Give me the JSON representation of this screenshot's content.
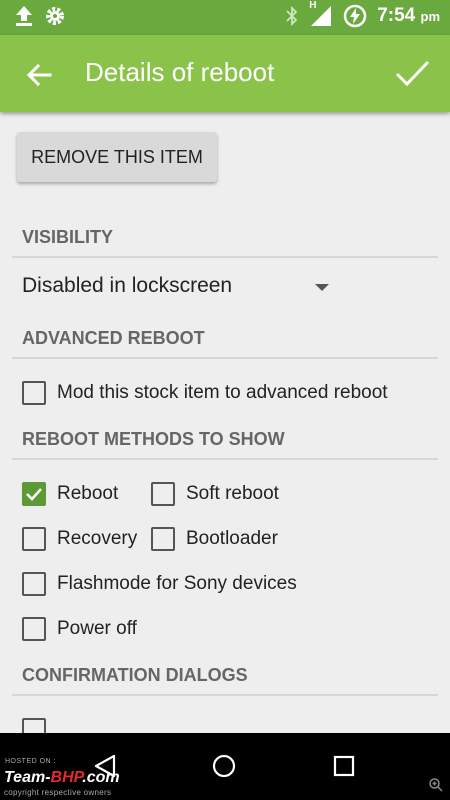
{
  "status_bar": {
    "time": "7:54",
    "ampm": "pm",
    "network": "H",
    "left_icons": [
      "upload-icon",
      "settings-icon"
    ],
    "right_icons": [
      "bluetooth-icon",
      "signal-icon",
      "battery-charging-icon"
    ]
  },
  "toolbar": {
    "title": "Details of reboot",
    "back_icon": "arrow-back-icon",
    "confirm_icon": "check-icon",
    "color": "#8bc34a"
  },
  "remove_button": {
    "label": "REMOVE THIS ITEM"
  },
  "sections": {
    "visibility": {
      "header": "VISIBILITY",
      "selected": "Disabled in lockscreen"
    },
    "advanced_reboot": {
      "header": "ADVANCED REBOOT",
      "option": {
        "label": "Mod this stock item to advanced reboot",
        "checked": false
      }
    },
    "reboot_methods": {
      "header": "REBOOT METHODS TO SHOW",
      "items": [
        {
          "label": "Reboot",
          "checked": true
        },
        {
          "label": "Soft reboot",
          "checked": false
        },
        {
          "label": "Recovery",
          "checked": false
        },
        {
          "label": "Bootloader",
          "checked": false
        },
        {
          "label": "Flashmode for Sony devices",
          "checked": false
        },
        {
          "label": "Power off",
          "checked": false
        }
      ]
    },
    "confirmation": {
      "header": "CONFIRMATION DIALOGS"
    }
  },
  "nav_bar": {
    "icons": [
      "back-triangle-icon",
      "home-circle-icon",
      "recents-square-icon"
    ]
  },
  "watermark": {
    "hosted": "HOSTED ON :",
    "brand_a": "Team-",
    "brand_b": "BHP",
    "brand_c": ".com",
    "sub": "copyright respective owners"
  },
  "accent_color": "#5d9a35"
}
